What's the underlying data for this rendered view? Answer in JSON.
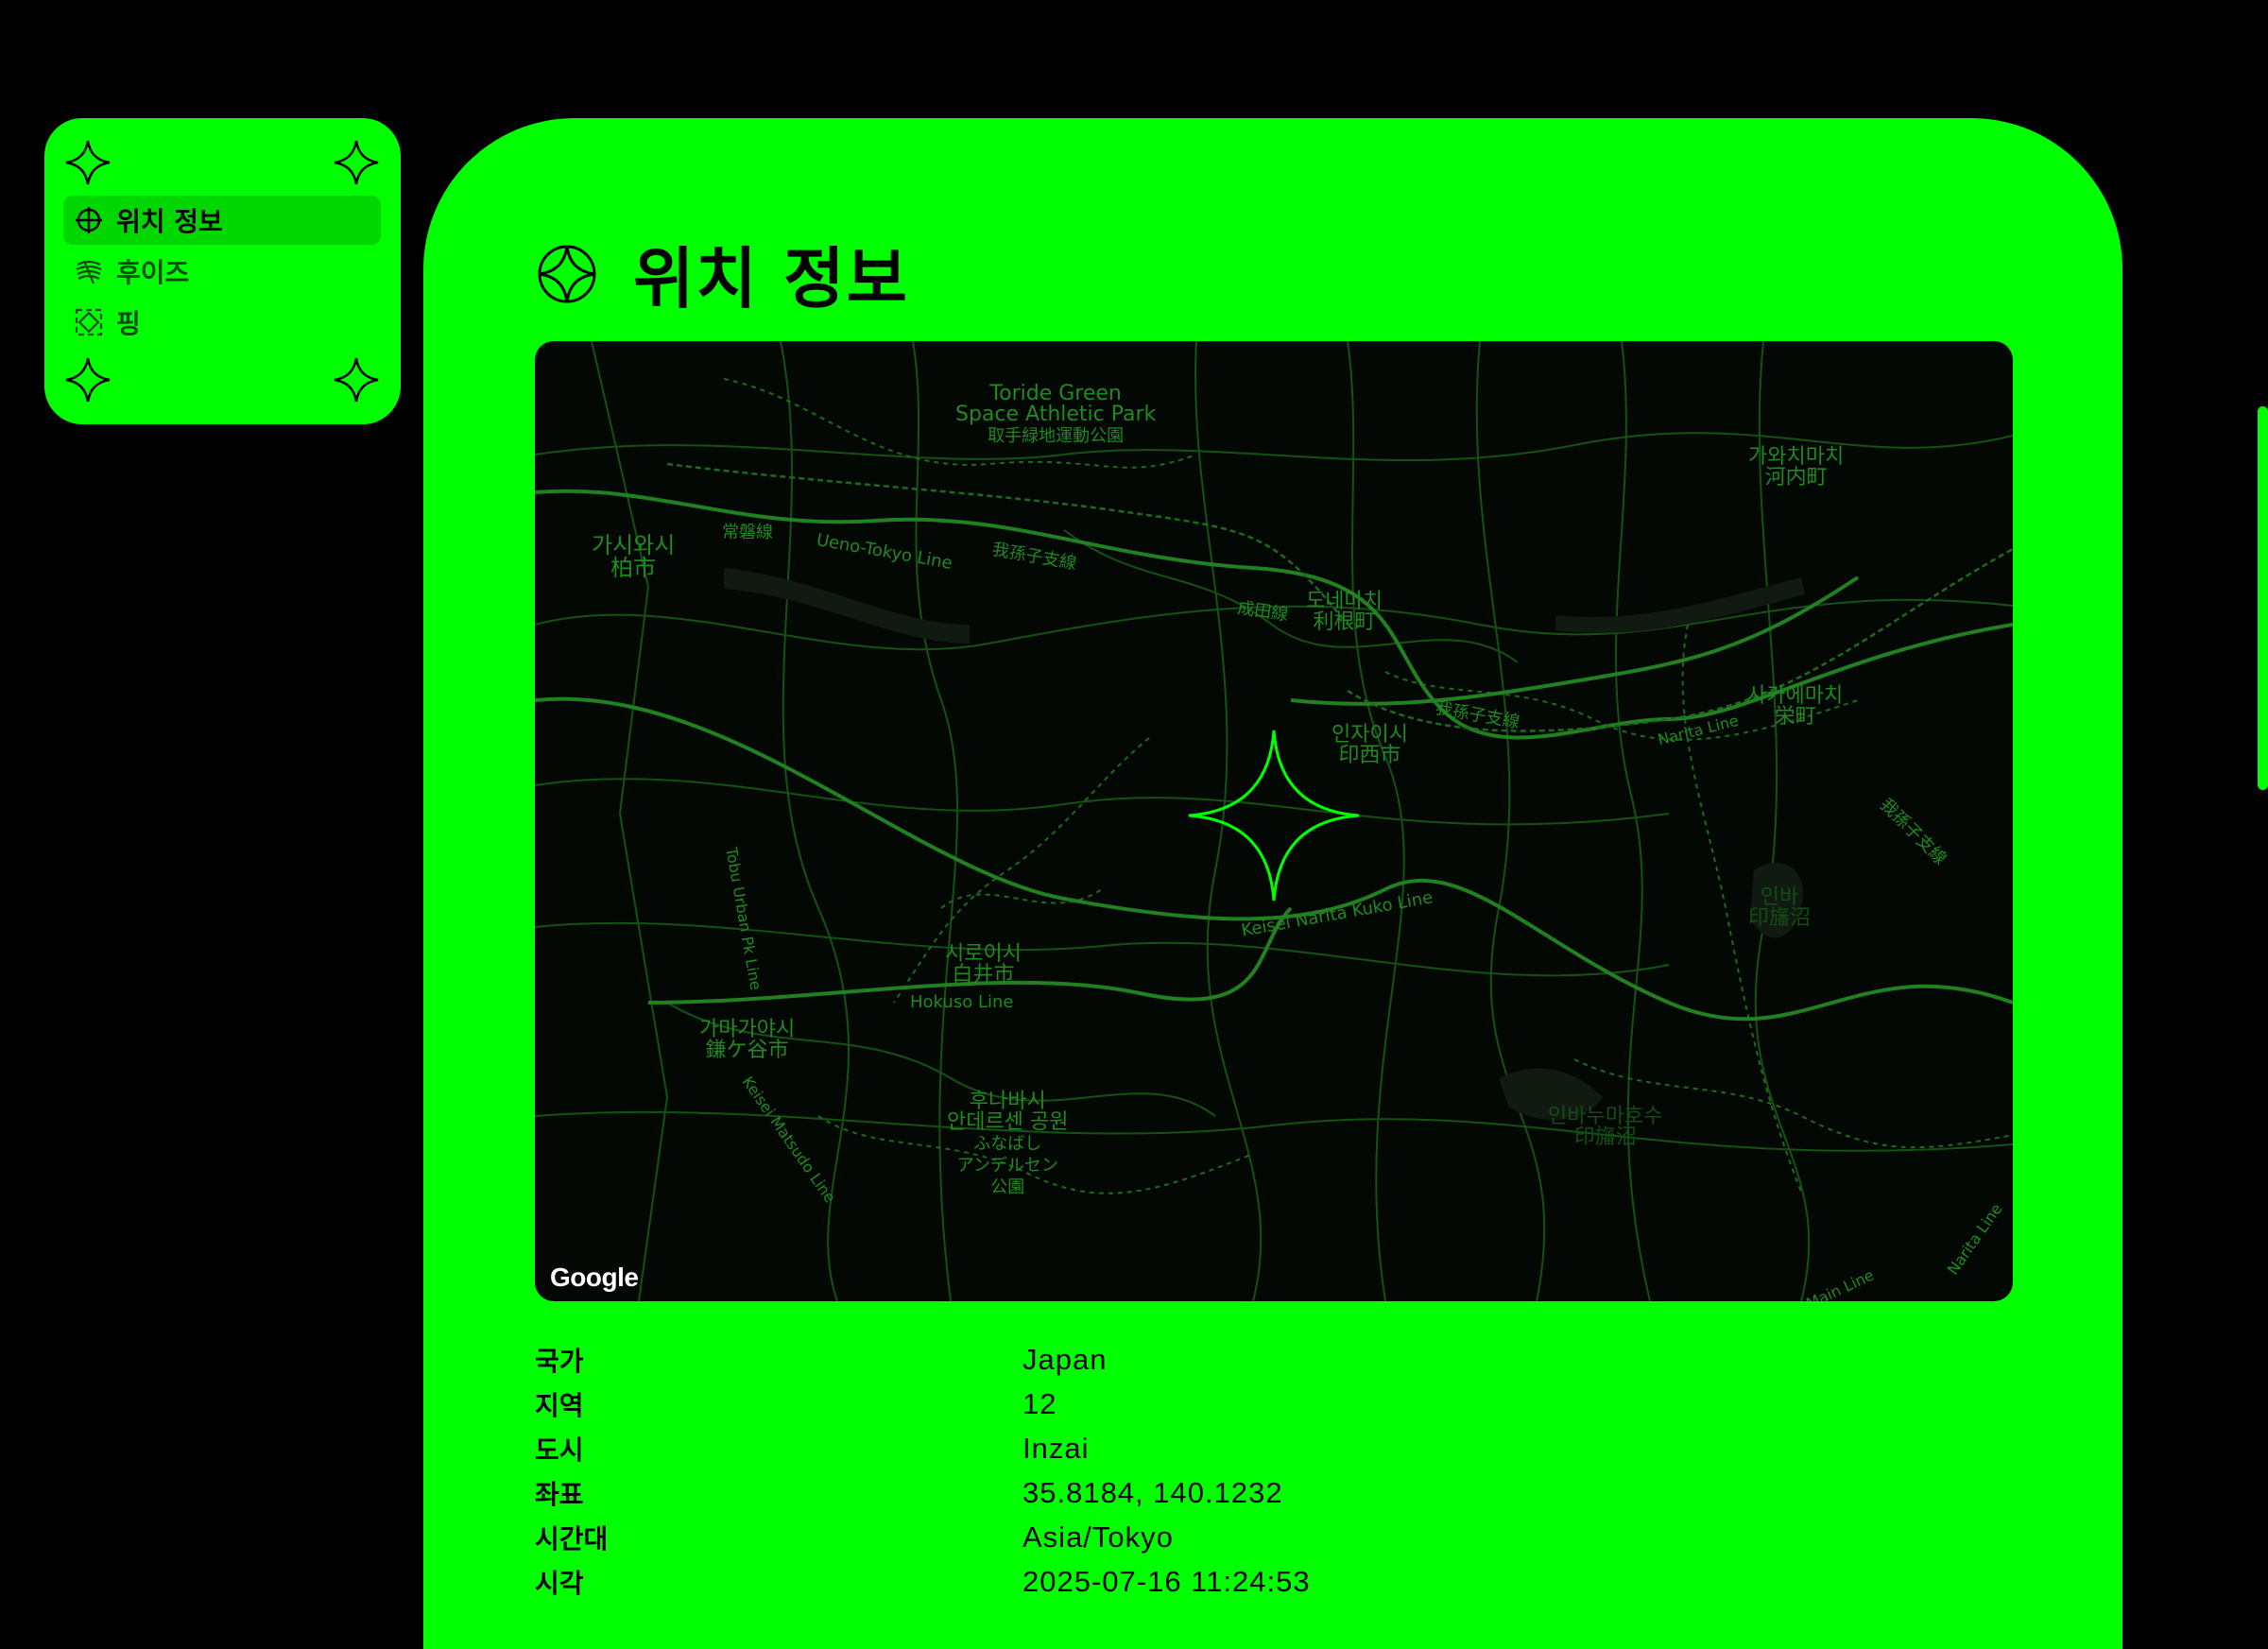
{
  "sidebar": {
    "items": [
      {
        "label": "위치 정보",
        "icon": "crosshair-icon",
        "active": true
      },
      {
        "label": "후이즈",
        "icon": "fingerprint-icon",
        "active": false
      },
      {
        "label": "핑",
        "icon": "ping-icon",
        "active": false
      }
    ]
  },
  "main": {
    "title": "위치 정보",
    "map": {
      "attribution": "Google",
      "labels": {
        "toride_park": "Toride Green\nSpace Athletic Park\n取手緑地運動公園",
        "kashiwa": "가시와시\n柏市",
        "tone": "도네마치\n利根町",
        "kawachi": "가와치마치\n河内町",
        "sakae": "사카에마치\n栄町",
        "inzai": "인자이시\n印西市",
        "shiroi": "시로이시\n白井市",
        "kamagaya": "가마가야시\n鎌ケ谷市",
        "funabashi_park": "후나바시\n안데르센 공원\nふなばし\nアンデルセン\n公園",
        "inbanuma": "인바누마호수\n印旛沼",
        "inba_small": "인바\n印旛沼",
        "joban": "常磐線",
        "ueno_tokyo": "Ueno-Tokyo Line",
        "abiko_line_1": "我孫子支線",
        "narita_sen": "成田線",
        "abiko_line_2": "我孫子支線",
        "narita_line": "Narita Line",
        "narita_line_2": "Narita Line",
        "abiko_line_3": "我孫子支線",
        "keisei_narita": "Keisei Narita Kuko Line",
        "hokuso": "Hokuso Line",
        "tobu": "Tobu Urban Pk Line",
        "keisei_matsudo": "Keisei Matsudo Line",
        "main_line": "Main Line"
      }
    },
    "info": [
      {
        "key": "국가",
        "value": "Japan"
      },
      {
        "key": "지역",
        "value": "12"
      },
      {
        "key": "도시",
        "value": "Inzai"
      },
      {
        "key": "좌표",
        "value": "35.8184, 140.1232"
      },
      {
        "key": "시간대",
        "value": "Asia/Tokyo"
      },
      {
        "key": "시각",
        "value": "2025-07-16 11:24:53"
      }
    ]
  },
  "colors": {
    "accent": "#00ff00",
    "background": "#000000",
    "map_bg": "#040804",
    "map_line": "#1c6b1c"
  }
}
